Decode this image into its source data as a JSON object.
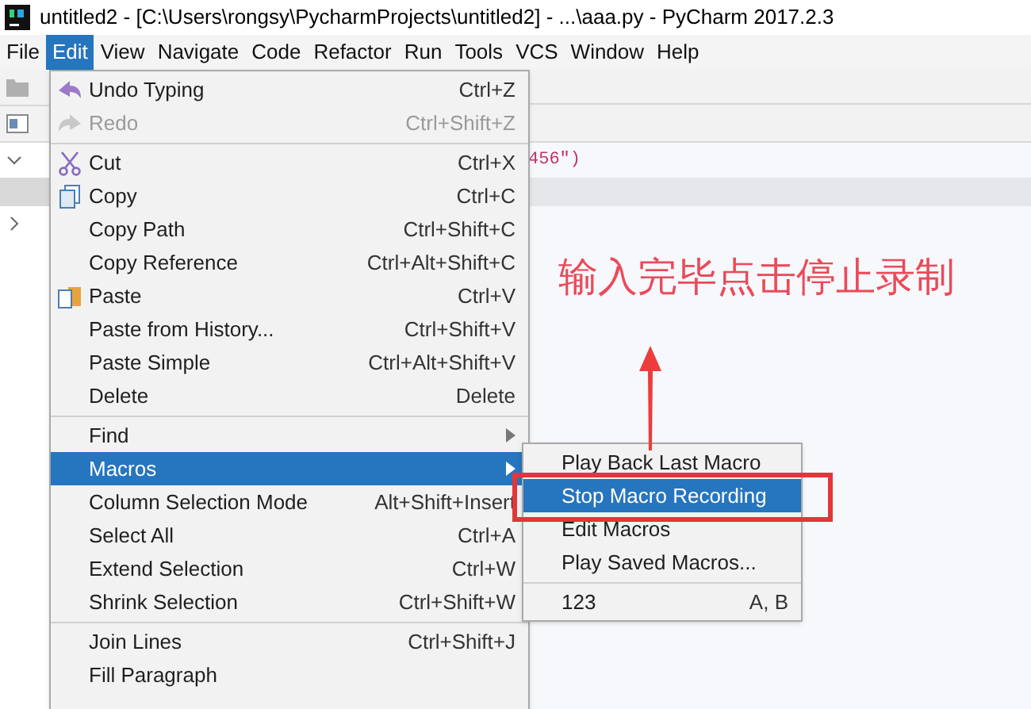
{
  "window": {
    "title": "untitled2 - [C:\\Users\\rongsy\\PycharmProjects\\untitled2] - ...\\aaa.py - PyCharm 2017.2.3"
  },
  "menu_bar": [
    {
      "label": "File",
      "selected": false
    },
    {
      "label": "Edit",
      "selected": true
    },
    {
      "label": "View",
      "selected": false
    },
    {
      "label": "Navigate",
      "selected": false
    },
    {
      "label": "Code",
      "selected": false
    },
    {
      "label": "Refactor",
      "selected": false
    },
    {
      "label": "Run",
      "selected": false
    },
    {
      "label": "Tools",
      "selected": false
    },
    {
      "label": "VCS",
      "selected": false
    },
    {
      "label": "Window",
      "selected": false
    },
    {
      "label": "Help",
      "selected": false
    }
  ],
  "editor": {
    "code_fragment": "456\")"
  },
  "edit_menu": [
    {
      "kind": "undo",
      "label": "Undo Typing",
      "shortcut": "Ctrl+Z",
      "disabled": false,
      "selected": false
    },
    {
      "kind": "redo",
      "label": "Redo",
      "shortcut": "Ctrl+Shift+Z",
      "disabled": true,
      "selected": false
    },
    {
      "kind": "separator"
    },
    {
      "kind": "cut",
      "label": "Cut",
      "shortcut": "Ctrl+X",
      "disabled": false,
      "selected": false
    },
    {
      "kind": "copy",
      "label": "Copy",
      "shortcut": "Ctrl+C",
      "disabled": false,
      "selected": false
    },
    {
      "kind": "plain",
      "label": "Copy Path",
      "shortcut": "Ctrl+Shift+C",
      "disabled": false,
      "selected": false
    },
    {
      "kind": "plain",
      "label": "Copy Reference",
      "shortcut": "Ctrl+Alt+Shift+C",
      "disabled": false,
      "selected": false
    },
    {
      "kind": "paste",
      "label": "Paste",
      "shortcut": "Ctrl+V",
      "disabled": false,
      "selected": false
    },
    {
      "kind": "plain",
      "label": "Paste from History...",
      "shortcut": "Ctrl+Shift+V",
      "disabled": false,
      "selected": false
    },
    {
      "kind": "plain",
      "label": "Paste Simple",
      "shortcut": "Ctrl+Alt+Shift+V",
      "disabled": false,
      "selected": false
    },
    {
      "kind": "plain",
      "label": "Delete",
      "shortcut": "Delete",
      "disabled": false,
      "selected": false
    },
    {
      "kind": "separator"
    },
    {
      "kind": "submenu",
      "label": "Find",
      "disabled": false,
      "selected": false
    },
    {
      "kind": "submenu",
      "label": "Macros",
      "disabled": false,
      "selected": true
    },
    {
      "kind": "plain",
      "label": "Column Selection Mode",
      "shortcut": "Alt+Shift+Insert",
      "disabled": false,
      "selected": false
    },
    {
      "kind": "plain",
      "label": "Select All",
      "shortcut": "Ctrl+A",
      "disabled": false,
      "selected": false
    },
    {
      "kind": "plain",
      "label": "Extend Selection",
      "shortcut": "Ctrl+W",
      "disabled": false,
      "selected": false
    },
    {
      "kind": "plain",
      "label": "Shrink Selection",
      "shortcut": "Ctrl+Shift+W",
      "disabled": false,
      "selected": false
    },
    {
      "kind": "separator"
    },
    {
      "kind": "plain",
      "label": "Join Lines",
      "shortcut": "Ctrl+Shift+J",
      "disabled": false,
      "selected": false
    },
    {
      "kind": "plain",
      "label": "Fill Paragraph",
      "disabled": false,
      "selected": false
    }
  ],
  "macros_submenu": [
    {
      "kind": "plain",
      "label": "Play Back Last Macro",
      "selected": false
    },
    {
      "kind": "plain",
      "label": "Stop Macro Recording",
      "selected": true
    },
    {
      "kind": "plain",
      "label": "Edit Macros",
      "selected": false
    },
    {
      "kind": "plain",
      "label": "Play Saved Macros...",
      "selected": false
    },
    {
      "kind": "separator"
    },
    {
      "kind": "plain",
      "label": "123",
      "shortcut": "A, B",
      "selected": false
    }
  ],
  "annotation": {
    "text": "输入完毕点击停止录制"
  }
}
